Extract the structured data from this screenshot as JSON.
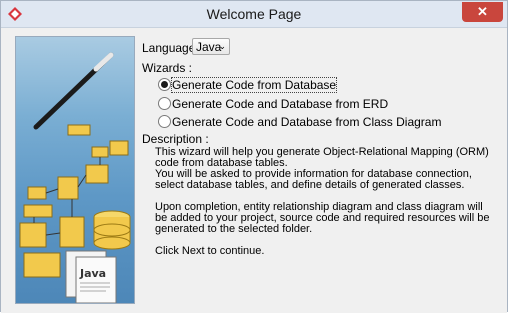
{
  "window": {
    "title": "Welcome Page",
    "close_symbol": "✕"
  },
  "language": {
    "label": "Language :",
    "value": "Java",
    "arrow": "⌄"
  },
  "wizards": {
    "label": "Wizards :",
    "options": [
      {
        "label": "Generate Code from Database",
        "selected": true
      },
      {
        "label": "Generate Code and Database from ERD",
        "selected": false
      },
      {
        "label": "Generate Code and Database from Class Diagram",
        "selected": false
      }
    ]
  },
  "description": {
    "label": "Description :",
    "paragraphs": [
      "This wizard will help you generate Object-Relational Mapping (ORM) code from database tables.",
      "You will be asked to provide information for database connection, select database tables, and define details of generated classes.",
      "Upon completion, entity relationship diagram and class diagram will be added to your project, source code and required resources will be generated to the selected folder.",
      "Click Next to continue."
    ]
  },
  "side_image": {
    "doc_text": "Java"
  },
  "colors": {
    "titlebar": "#dfe7f2",
    "close": "#c9463d",
    "panel": "#f0f0f0"
  }
}
